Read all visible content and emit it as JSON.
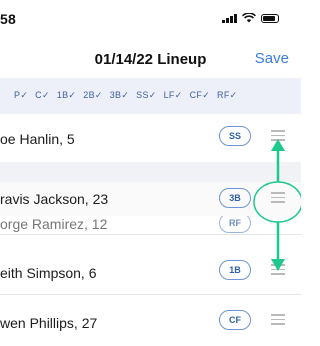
{
  "status_bar": {
    "time": "58",
    "icons": [
      "signal-icon",
      "wifi-icon",
      "battery-icon"
    ]
  },
  "nav": {
    "title": "01/14/22 Lineup",
    "save_label": "Save"
  },
  "positions": [
    "P",
    "C",
    "1B",
    "2B",
    "3B",
    "SS",
    "LF",
    "CF",
    "RF"
  ],
  "rows": [
    {
      "name": "oe Hanlin, 5",
      "position": "SS"
    },
    {
      "name": "ravis Jackson, 23",
      "position": "3B"
    },
    {
      "name": "orge Ramirez, 12",
      "position": "RF"
    },
    {
      "name": "eith Simpson, 6",
      "position": "1B"
    },
    {
      "name": "wen Phillips, 27",
      "position": "CF"
    }
  ],
  "colors": {
    "accent": "#3b7de0",
    "badge_border": "#6f95d6",
    "annotation": "#1ec98b",
    "position_bar_bg": "#edf0f8"
  }
}
